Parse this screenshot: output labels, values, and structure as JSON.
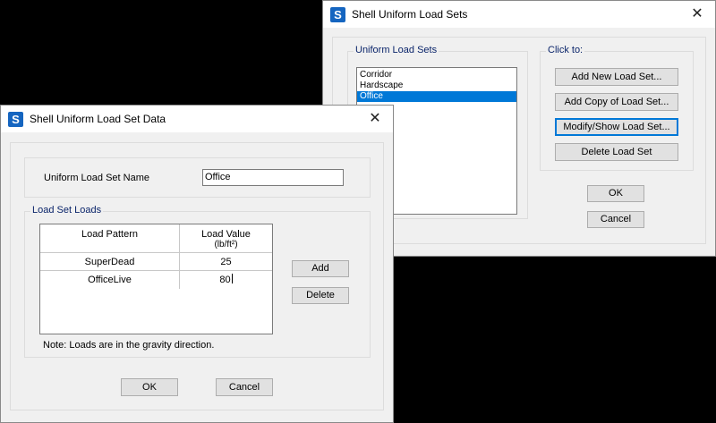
{
  "sets_dialog": {
    "title": "Shell Uniform Load Sets",
    "list_group_label": "Uniform Load Sets",
    "items": [
      "Corridor",
      "Hardscape",
      "Office"
    ],
    "selected_index": 2,
    "click_to_label": "Click to:",
    "buttons": {
      "add_new": "Add New Load Set...",
      "add_copy": "Add Copy of Load Set...",
      "modify": "Modify/Show Load Set...",
      "delete": "Delete Load Set"
    },
    "ok": "OK",
    "cancel": "Cancel",
    "close_glyph": "✕",
    "icon_letter": "S"
  },
  "data_dialog": {
    "title": "Shell Uniform Load Set Data",
    "name_label": "Uniform Load Set Name",
    "name_value": "Office",
    "loads_group_label": "Load Set Loads",
    "col_pattern": "Load Pattern",
    "col_value": "Load Value",
    "col_value_unit": "(lb/ft²)",
    "rows": [
      {
        "pattern": "SuperDead",
        "value": "25"
      },
      {
        "pattern": "OfficeLive",
        "value": "80"
      }
    ],
    "add": "Add",
    "delete": "Delete",
    "note": "Note:  Loads are in the gravity direction.",
    "ok": "OK",
    "cancel": "Cancel",
    "close_glyph": "✕",
    "icon_letter": "S"
  },
  "colors": {
    "selection": "#0078d7",
    "app_icon": "#1565c0",
    "group_label": "#0a246a"
  }
}
